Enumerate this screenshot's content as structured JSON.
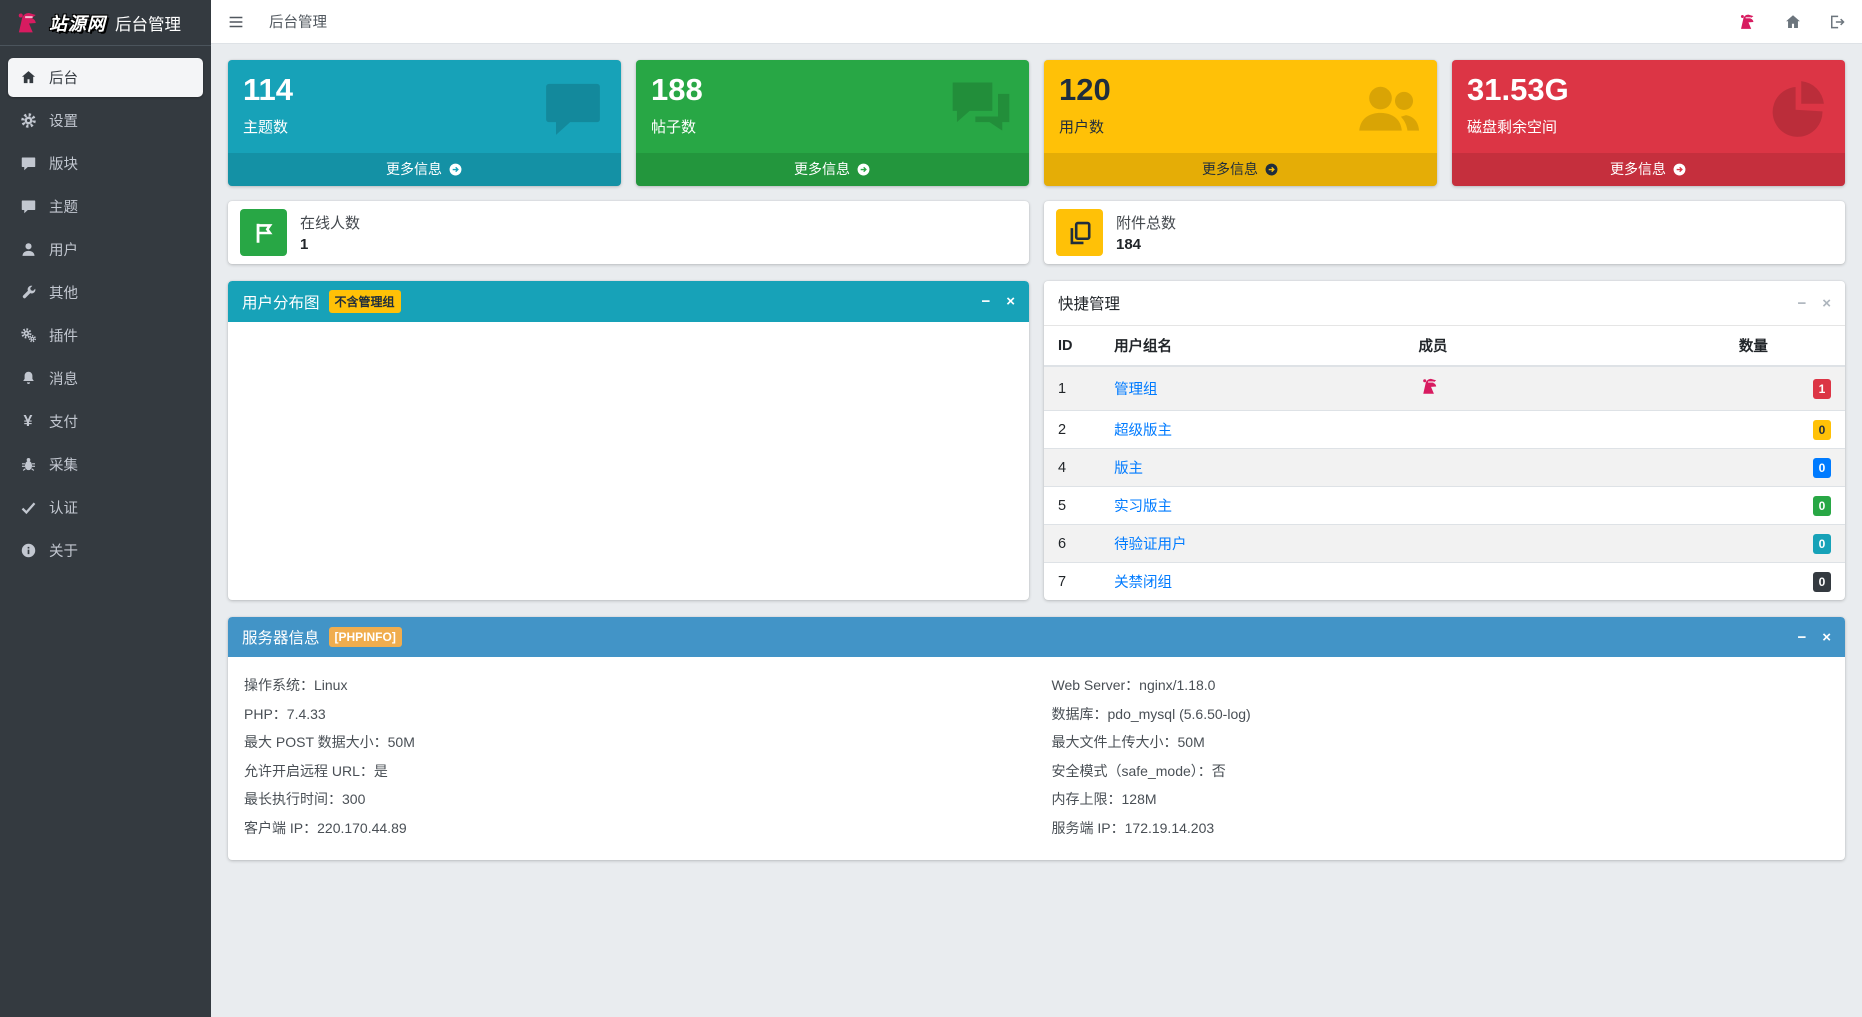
{
  "brand": {
    "site_name": "站源网",
    "title": "后台管理"
  },
  "navbar": {
    "breadcrumb": "后台管理",
    "right_icons": [
      "avatar",
      "home-icon",
      "sign-out-icon"
    ]
  },
  "sidebar": {
    "items": [
      {
        "key": "dashboard",
        "icon": "home-icon",
        "label": "后台",
        "active": true
      },
      {
        "key": "settings",
        "icon": "gear-icon",
        "label": "设置"
      },
      {
        "key": "forums",
        "icon": "comment-icon",
        "label": "版块"
      },
      {
        "key": "threads",
        "icon": "comment-icon",
        "label": "主题"
      },
      {
        "key": "users",
        "icon": "user-icon",
        "label": "用户"
      },
      {
        "key": "other",
        "icon": "wrench-icon",
        "label": "其他"
      },
      {
        "key": "plugins",
        "icon": "cogs-icon",
        "label": "插件"
      },
      {
        "key": "messages",
        "icon": "bell-icon",
        "label": "消息"
      },
      {
        "key": "payment",
        "icon": "yen-icon",
        "label": "支付"
      },
      {
        "key": "collect",
        "icon": "bug-icon",
        "label": "采集"
      },
      {
        "key": "auth",
        "icon": "check-icon",
        "label": "认证"
      },
      {
        "key": "about",
        "icon": "info-icon",
        "label": "关于"
      }
    ]
  },
  "stat_cards": [
    {
      "key": "topics",
      "value": "114",
      "label": "主题数",
      "icon": "comment-icon",
      "color": "#17a2b8",
      "text": "#ffffff",
      "more_label": "更多信息"
    },
    {
      "key": "posts",
      "value": "188",
      "label": "帖子数",
      "icon": "comments-icon",
      "color": "#28a745",
      "text": "#ffffff",
      "more_label": "更多信息"
    },
    {
      "key": "users",
      "value": "120",
      "label": "用户数",
      "icon": "users-icon",
      "color": "#ffc107",
      "text": "#1f2d3d",
      "more_label": "更多信息"
    },
    {
      "key": "disk",
      "value": "31.53G",
      "label": "磁盘剩余空间",
      "icon": "pie-chart-icon",
      "color": "#dc3545",
      "text": "#ffffff",
      "more_label": "更多信息"
    }
  ],
  "info_boxes": [
    {
      "key": "online",
      "label": "在线人数",
      "value": "1",
      "icon": "flag-icon",
      "icon_bg": "#28a745",
      "icon_color": "#ffffff"
    },
    {
      "key": "attachments",
      "label": "附件总数",
      "value": "184",
      "icon": "copy-icon",
      "icon_bg": "#ffc107",
      "icon_color": "#1f2d3d"
    }
  ],
  "distribution_panel": {
    "title": "用户分布图",
    "badge": "不含管理组",
    "tools": [
      "minimize-icon",
      "close-icon"
    ]
  },
  "quick_panel": {
    "title": "快捷管理",
    "tools": [
      "minimize-icon",
      "close-icon"
    ],
    "table": {
      "headers": [
        "ID",
        "用户组名",
        "成员",
        "数量"
      ],
      "rows": [
        {
          "id": "1",
          "group": "管理组",
          "has_member_avatar": true,
          "count": "1",
          "badge_bg": "#dc3545",
          "badge_text": "#ffffff"
        },
        {
          "id": "2",
          "group": "超级版主",
          "has_member_avatar": false,
          "count": "0",
          "badge_bg": "#ffc107",
          "badge_text": "#1f2d3d"
        },
        {
          "id": "4",
          "group": "版主",
          "has_member_avatar": false,
          "count": "0",
          "badge_bg": "#007bff",
          "badge_text": "#ffffff"
        },
        {
          "id": "5",
          "group": "实习版主",
          "has_member_avatar": false,
          "count": "0",
          "badge_bg": "#28a745",
          "badge_text": "#ffffff"
        },
        {
          "id": "6",
          "group": "待验证用户",
          "has_member_avatar": false,
          "count": "0",
          "badge_bg": "#17a2b8",
          "badge_text": "#ffffff"
        },
        {
          "id": "7",
          "group": "关禁闭组",
          "has_member_avatar": false,
          "count": "0",
          "badge_bg": "#343a40",
          "badge_text": "#ffffff"
        }
      ]
    }
  },
  "server_panel": {
    "title": "服务器信息",
    "badge": "[PHPINFO]",
    "tools": [
      "minimize-icon",
      "close-icon"
    ],
    "left_lines": [
      "操作系统：Linux",
      "PHP：7.4.33",
      "最大 POST 数据大小：50M",
      "允许开启远程 URL：是",
      "最长执行时间：300",
      "客户端 IP：220.170.44.89"
    ],
    "right_lines": [
      "Web Server：nginx/1.18.0",
      "数据库：pdo_mysql (5.6.50-log)",
      "最大文件上传大小：50M",
      "安全模式（safe_mode）：否",
      "内存上限：128M",
      "服务端 IP：172.19.14.203"
    ]
  },
  "colors": {
    "info": "#17a2b8",
    "success": "#28a745",
    "warning": "#ffc107",
    "danger": "#dc3545",
    "primary": "#007bff",
    "header_blue": "#4294c7",
    "sidebar": "#343a40",
    "link": "#007bff"
  }
}
